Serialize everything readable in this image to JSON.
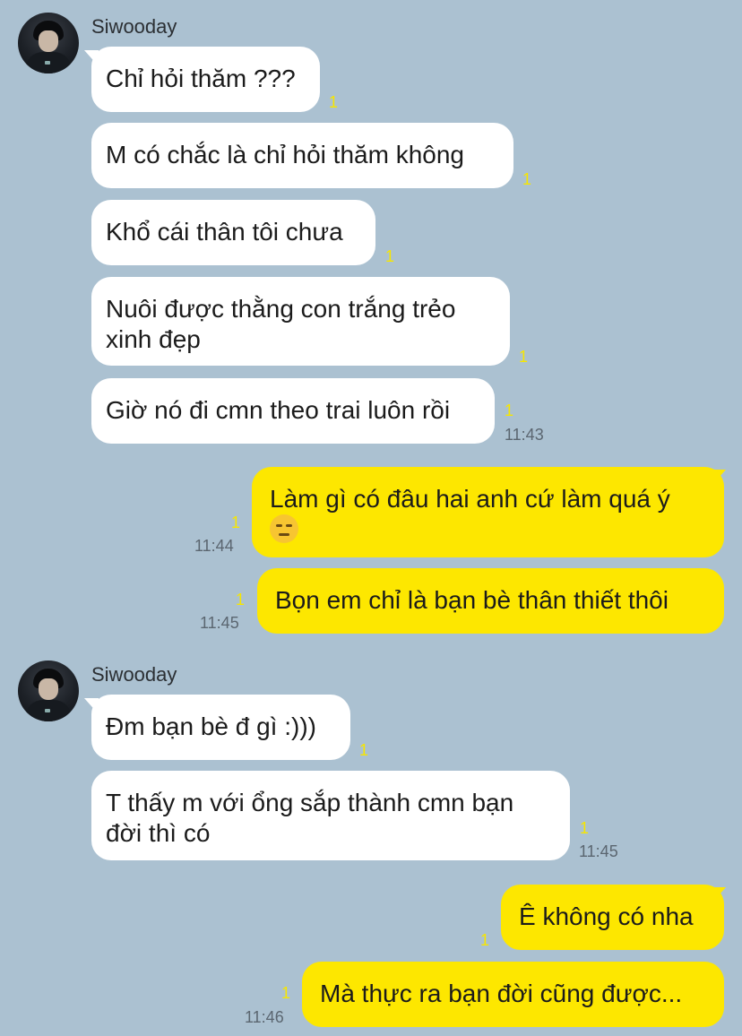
{
  "groups": [
    {
      "sender": "Siwooday",
      "messages": [
        {
          "text": "Chỉ hỏi thăm ???",
          "read": "1"
        },
        {
          "text": "M có chắc là chỉ hỏi thăm không",
          "read": "1"
        },
        {
          "text": "Khổ cái thân tôi chưa",
          "read": "1"
        },
        {
          "text": "Nuôi được thằng con trắng trẻo\nxinh đẹp",
          "read": "1"
        },
        {
          "text": "Giờ nó đi cmn theo trai luôn rồi",
          "read": "1",
          "time": "11:43"
        }
      ]
    },
    {
      "sender": "me",
      "messages": [
        {
          "text": "Làm gì có đâu hai anh cứ làm quá ý",
          "emoji": "expressionless-face-emoji",
          "read": "1",
          "time": "11:44"
        },
        {
          "text": "Bọn em chỉ là bạn bè thân thiết thôi",
          "read": "1",
          "time": "11:45"
        }
      ]
    },
    {
      "sender": "Siwooday",
      "messages": [
        {
          "text": "Đm bạn bè đ gì :)))",
          "read": "1"
        },
        {
          "text": "T thấy m với ổng sắp thành cmn bạn\nđời thì có",
          "read": "1",
          "time": "11:45"
        }
      ]
    },
    {
      "sender": "me",
      "messages": [
        {
          "text": "Ê không có nha",
          "read": "1"
        },
        {
          "text": "Mà thực ra bạn đời cũng được...",
          "read": "1",
          "time": "11:46"
        }
      ]
    }
  ],
  "colors": {
    "background": "#abc1d1",
    "incoming_bubble": "#ffffff",
    "outgoing_bubble": "#fde700",
    "read_count": "#f7e600",
    "timestamp": "#5b6670"
  }
}
